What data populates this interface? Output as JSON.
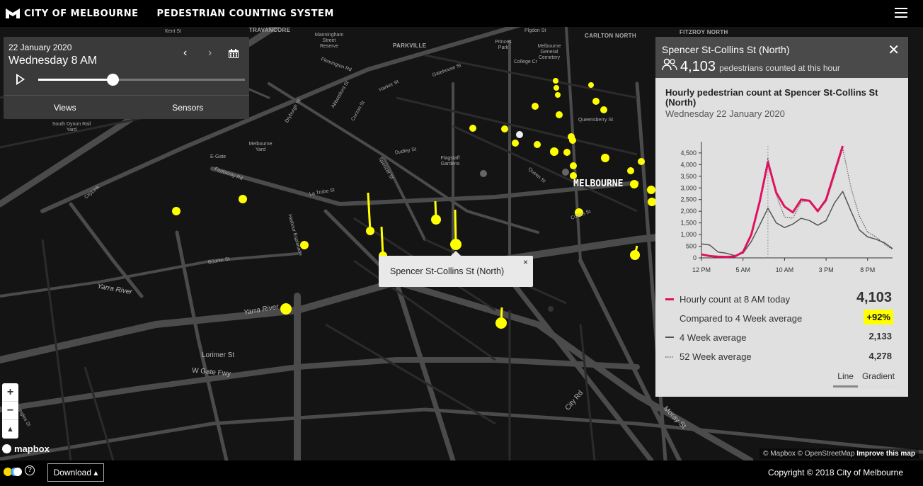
{
  "header": {
    "org": "CITY OF MELBOURNE",
    "title": "PEDESTRIAN COUNTING SYSTEM"
  },
  "controls": {
    "date": "22 January 2020",
    "day_time": "Wednesday 8 AM",
    "slider_progress": 0.36,
    "tabs": [
      "Views",
      "Sensors"
    ]
  },
  "map_labels": {
    "travancore": "TRAVANCORE",
    "parkville": "PARKVILLE",
    "carlton_north": "CARLTON NORTH",
    "fitzroy_north": "FITZROY NORTH",
    "kent_st": "Kent St",
    "plgdon_st": "Plgdon St",
    "flemington_rd": "Flemington Rd",
    "harker_st": "Harker St",
    "gatehouse_st": "Gatehouse St",
    "college_cr": "College Cr",
    "queensberry_st": "Queensberry St",
    "dudley_st": "Dudley St",
    "footscray_rd": "Footscray Rd",
    "latrobe_st": "La Trobe St",
    "queen_st": "Queen St",
    "collins_st": "Collins St",
    "melbourne": "MELBOURNE",
    "bourke_st": "Bourke St",
    "harbour_esp": "Harbour Esplanade",
    "yarra_river_1": "Yarra River",
    "yarra_river_2": "Yarra River",
    "lorimer_st": "Lorimer St",
    "wgate_fwy": "W Gate Fwy",
    "city_rd": "City Rd",
    "moray_st": "Moray St",
    "spencer_st": "Spencer St",
    "citylink": "CityLink",
    "egate": "E-Gate",
    "curzon_st": "Curzon St",
    "drybugh_st": "Dryburgh St",
    "abbotsford_st": "Abbotsford St",
    "ingles_st": "Ingles St",
    "princes_park": "Princes Park",
    "flagstaff": "Flagstaff Gardens",
    "mel_gen_cem": "Melbourne General Cemetery",
    "mel_yard": "Melbourne Yard",
    "sth_dynon": "South Dynon Rail Yard",
    "mann_reserve": "Manningham Street Reserve"
  },
  "tooltip": {
    "name": "Spencer St-Collins St (North)",
    "close": "×"
  },
  "panel": {
    "sensor_name": "Spencer St-Collins St (North)",
    "count": "4,103",
    "count_unit": "pedestrians counted at this hour",
    "chart_title": "Hourly pedestrian count at Spencer St-Collins St (North)",
    "chart_subtitle": "Wednesday 22 January 2020",
    "legend": [
      {
        "label": "Hourly count at 8 AM today",
        "value": "4,103"
      },
      {
        "label": "Compared to 4 Week average",
        "value": "+92%"
      },
      {
        "label": "4 Week average",
        "value": "2,133"
      },
      {
        "label": "52 Week average",
        "value": "4,278"
      }
    ],
    "view_tabs": [
      "Line",
      "Gradient"
    ]
  },
  "chart_data": {
    "type": "line",
    "x": [
      "12 PM",
      "1 AM",
      "2 AM",
      "3 AM",
      "4 AM",
      "5 AM",
      "6 AM",
      "7 AM",
      "8 AM",
      "9 AM",
      "10 AM",
      "11 AM",
      "12 PM",
      "1 PM",
      "2 PM",
      "3 PM",
      "4 PM",
      "5 PM",
      "6 PM",
      "7 PM",
      "8 PM",
      "9 PM",
      "10 PM",
      "11 PM"
    ],
    "x_ticks": [
      "12 PM",
      "5 AM",
      "10 AM",
      "3 PM",
      "8 PM"
    ],
    "ylim": [
      0,
      4800
    ],
    "y_ticks": [
      "0",
      "500",
      "1,000",
      "1,500",
      "2,000",
      "2,500",
      "3,000",
      "3,500",
      "4,000",
      "4,500"
    ],
    "marker_hour": 8,
    "series": [
      {
        "name": "Hourly count at 8 AM today",
        "color": "#e0115f",
        "values": [
          150,
          80,
          50,
          40,
          60,
          250,
          1000,
          2400,
          4103,
          2800,
          2200,
          1950,
          2500,
          2450,
          2000,
          2500,
          3650,
          4800
        ]
      },
      {
        "name": "4 Week average",
        "color": "#555555",
        "values": [
          600,
          550,
          250,
          200,
          100,
          200,
          700,
          1400,
          2133,
          1500,
          1300,
          1450,
          1700,
          1600,
          1400,
          1600,
          2350,
          2850,
          2000,
          1200,
          900,
          800,
          650,
          400
        ]
      },
      {
        "name": "52 Week average",
        "color": "#666666",
        "values": [
          150,
          90,
          60,
          50,
          70,
          260,
          1000,
          2400,
          4278,
          2700,
          1750,
          1700,
          2400,
          2450,
          2050,
          2400,
          3500,
          4700,
          3000,
          1800,
          1100,
          900,
          600,
          350
        ]
      }
    ]
  },
  "footer": {
    "download": "Download ▴",
    "copyright": "Copyright © 2018 City of Melbourne",
    "attrib_osm": "© Mapbox © OpenStreetMap",
    "attrib_improve": "Improve this map",
    "mapbox": "mapbox"
  }
}
